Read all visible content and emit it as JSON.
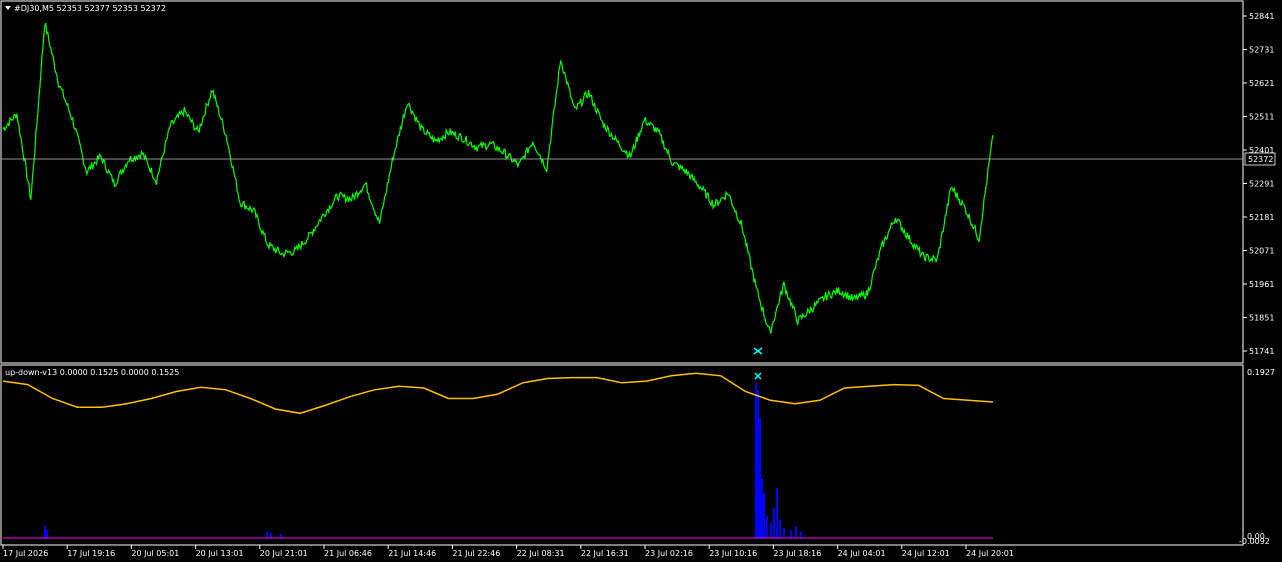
{
  "main_chart": {
    "header": "#DJ30,M5  52353 52377 52353 52372",
    "price_ticks": [
      "52841",
      "52731",
      "52621",
      "52511",
      "52401",
      "52291",
      "52181",
      "52071",
      "51961",
      "51851",
      "51741"
    ],
    "current_price": "52372",
    "colors": {
      "price_line": "#00ff00",
      "background": "#000000",
      "axis": "#ffffff",
      "bid_line": "#c0c0c0"
    }
  },
  "indicator": {
    "header": "up-down-v13 0.0000 0.1525 0.0000 0.1525",
    "ticks": [
      "0.1927",
      "0.00",
      "-0.0092"
    ],
    "colors": {
      "line": "#ffc000",
      "histogram_up": "#0000ff",
      "histogram_down": "#ff00ff",
      "marker": "#00ffff"
    }
  },
  "time_axis": {
    "labels": [
      "17 Jul 2026",
      "17 Jul 19:16",
      "20 Jul 05:01",
      "20 Jul 13:01",
      "20 Jul 21:01",
      "21 Jul 06:46",
      "21 Jul 14:46",
      "21 Jul 22:46",
      "22 Jul 08:31",
      "22 Jul 16:31",
      "23 Jul 02:16",
      "23 Jul 10:16",
      "23 Jul 18:16",
      "24 Jul 04:01",
      "24 Jul 12:01",
      "24 Jul 20:01"
    ]
  },
  "chart_data": [
    {
      "type": "line",
      "title": "#DJ30,M5  52353 52377 52353 52372",
      "ylim": [
        51720,
        52870
      ],
      "x": [
        "17 Jul 2026",
        "17 Jul 19:16",
        "20 Jul 05:01",
        "20 Jul 13:01",
        "20 Jul 21:01",
        "21 Jul 06:46",
        "21 Jul 14:46",
        "21 Jul 22:46",
        "22 Jul 08:31",
        "22 Jul 16:31",
        "23 Jul 02:16",
        "23 Jul 10:16",
        "23 Jul 18:16",
        "24 Jul 04:01",
        "24 Jul 12:01",
        "24 Jul 20:01"
      ],
      "series": [
        {
          "values": [
            52470,
            52520,
            52240,
            52820,
            52620,
            52500,
            52330,
            52380,
            52290,
            52370,
            52390,
            52300,
            52480,
            52530,
            52460,
            52600,
            52450,
            52230,
            52200,
            52090,
            52060,
            52070,
            52120,
            52190,
            52250,
            52240,
            52290,
            52160,
            52380,
            52560,
            52470,
            52430,
            52460,
            52440,
            52410,
            52420,
            52390,
            52350,
            52430,
            52340,
            52700,
            52530,
            52590,
            52490,
            52430,
            52380,
            52500,
            52460,
            52360,
            52330,
            52280,
            52220,
            52260,
            52150,
            51950,
            51800,
            51960,
            51840,
            51880,
            51920,
            51940,
            51910,
            51930,
            52080,
            52180,
            52110,
            52050,
            52040,
            52280,
            52210,
            52110,
            52450
          ]
        }
      ]
    },
    {
      "type": "line",
      "title": "up-down-v13 0.0000 0.1525 0.0000 0.1525",
      "ylim": [
        -0.0092,
        0.1927
      ],
      "series": [
        {
          "values": [
            0.18,
            0.176,
            0.16,
            0.15,
            0.15,
            0.154,
            0.16,
            0.168,
            0.173,
            0.17,
            0.16,
            0.148,
            0.143,
            0.152,
            0.162,
            0.17,
            0.174,
            0.172,
            0.16,
            0.16,
            0.165,
            0.178,
            0.183,
            0.184,
            0.184,
            0.178,
            0.18,
            0.186,
            0.189,
            0.186,
            0.168,
            0.158,
            0.154,
            0.158,
            0.172,
            0.174,
            0.176,
            0.175,
            0.16,
            0.158,
            0.156
          ]
        }
      ]
    }
  ]
}
